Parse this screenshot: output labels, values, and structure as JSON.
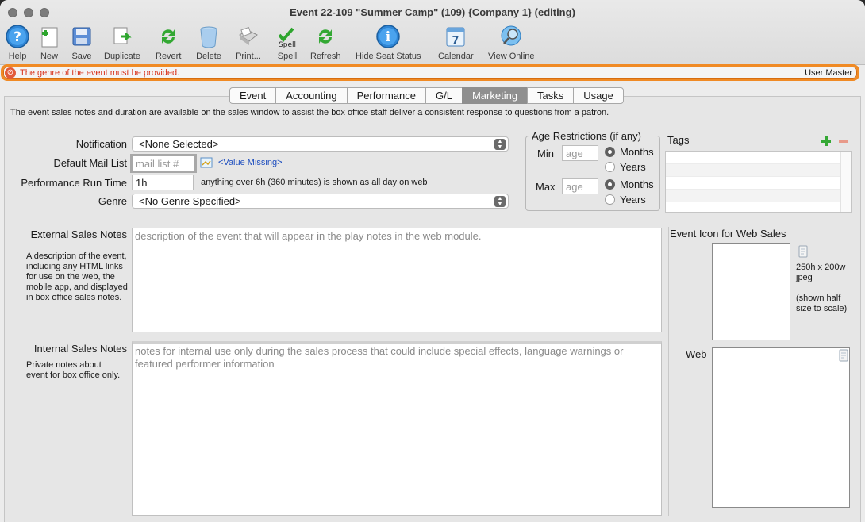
{
  "window": {
    "title": "Event 22-109 \"Summer Camp\" (109) {Company 1} (editing)"
  },
  "toolbar": {
    "help": "Help",
    "new": "New",
    "save": "Save",
    "duplicate": "Duplicate",
    "revert": "Revert",
    "delete": "Delete",
    "print": "Print...",
    "spell": "Spell",
    "spell_badge": "Spell",
    "refresh": "Refresh",
    "hide_seat_status": "Hide Seat Status",
    "calendar": "Calendar",
    "calendar_badge": "7",
    "view_online": "View Online"
  },
  "status": {
    "error": "The genre of the event must be provided.",
    "user": "User Master"
  },
  "tabs": [
    "Event",
    "Accounting",
    "Performance",
    "G/L",
    "Marketing",
    "Tasks",
    "Usage"
  ],
  "active_tab": "Marketing",
  "description": "The event sales notes and duration are available on the sales window to assist the box office staff deliver a consistent response to questions from a patron.",
  "form": {
    "notification_label": "Notification",
    "notification_value": "<None Selected>",
    "mail_list_label": "Default Mail List",
    "mail_list_placeholder": "mail list #",
    "mail_list_missing": "<Value Missing>",
    "run_time_label": "Performance Run Time",
    "run_time_value": "1h",
    "run_time_hint": "anything over 6h (360 minutes) is shown as all day on web",
    "genre_label": "Genre",
    "genre_value": "<No Genre Specified>"
  },
  "age": {
    "title": "Age Restrictions (if any)",
    "min_label": "Min",
    "max_label": "Max",
    "placeholder": "age",
    "months": "Months",
    "years": "Years",
    "min_selected": "Months",
    "max_selected": "Months"
  },
  "tags": {
    "label": "Tags"
  },
  "external": {
    "label": "External Sales Notes",
    "note": "A description of the event, including any HTML links for use on the web, the mobile app, and displayed in box office sales notes.",
    "placeholder": "description of the event that will appear in the play notes in the web module."
  },
  "internal": {
    "label": "Internal Sales Notes",
    "note": "Private notes about event for box office only.",
    "placeholder": "notes for internal use only during the sales process that could include special effects, language warnings or featured performer information"
  },
  "icon_section": {
    "title": "Event Icon for Web Sales",
    "size_hint": "250h x 200w jpeg",
    "scale_hint": "(shown half size to scale)",
    "web_label": "Web"
  },
  "colors": {
    "error_border": "#f08a24",
    "error_text": "#d8321b",
    "active_tab": "#8f8f8f",
    "link": "#1f4fbf"
  }
}
